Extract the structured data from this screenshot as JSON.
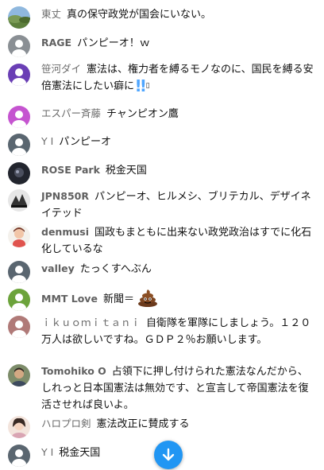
{
  "chat": {
    "messages": [
      {
        "author": "東丈",
        "text": "真の保守政党が国会にいない。",
        "avatar": "landscape"
      },
      {
        "author": "RAGE",
        "text": "パンピーオ！ｗ",
        "avatar": "default-gray"
      },
      {
        "author": "笹河ダイ",
        "text": "憲法は、権力者を縛るモノなのに、国民を縛る安倍憲法にしたい癖に",
        "emoji": "double-exclamation",
        "avatar": "default-purple"
      },
      {
        "author": "エスパー斉藤",
        "text": "チャンピオン鷹",
        "avatar": "default-pink"
      },
      {
        "author": "Y I",
        "text": "パンピーオ",
        "avatar": "default-slate"
      },
      {
        "author": "ROSE Park",
        "text": "税金天国",
        "avatar": "photo-dark"
      },
      {
        "author": "JPN850R",
        "text": "パンピーオ、ヒルメシ、ブリテカル、デザイネイテッド",
        "avatar": "photo-bw"
      },
      {
        "author": "denmusi",
        "text": "国政もまともに出来ない政党政治はすでに化石化しているな",
        "avatar": "photo-character"
      },
      {
        "author": "valley",
        "text": "たっくすへぶん",
        "avatar": "default-slate"
      },
      {
        "author": "MMT Love",
        "text": "新聞＝",
        "emoji": "poop",
        "avatar": "default-green"
      },
      {
        "author": "ｉｋｕｏｍｉｔａｎｉ",
        "text": "自衛隊を軍隊にしましょう。１２０万人は欲しいですね。ＧＤＰ２％お願いします。",
        "avatar": "default-rose"
      },
      {
        "author": "Tomohiko O",
        "text": "占領下に押し付けられた憲法なんだから、しれっと日本国憲法は無効です、と宣言して帝国憲法を復活させれば良いよ。",
        "avatar": "photo-face"
      },
      {
        "author": "ハロプロ剣",
        "text": "憲法改正に賛成する",
        "avatar": "photo-girl"
      },
      {
        "author": "Y I",
        "text": "税金天国",
        "avatar": "default-slate"
      }
    ]
  },
  "colors": {
    "author": "#606060",
    "text": "#111111",
    "fab": "#2196f3",
    "exclamation": "#4fa6ff"
  },
  "scroll_button": {
    "icon": "arrow-down-icon"
  }
}
